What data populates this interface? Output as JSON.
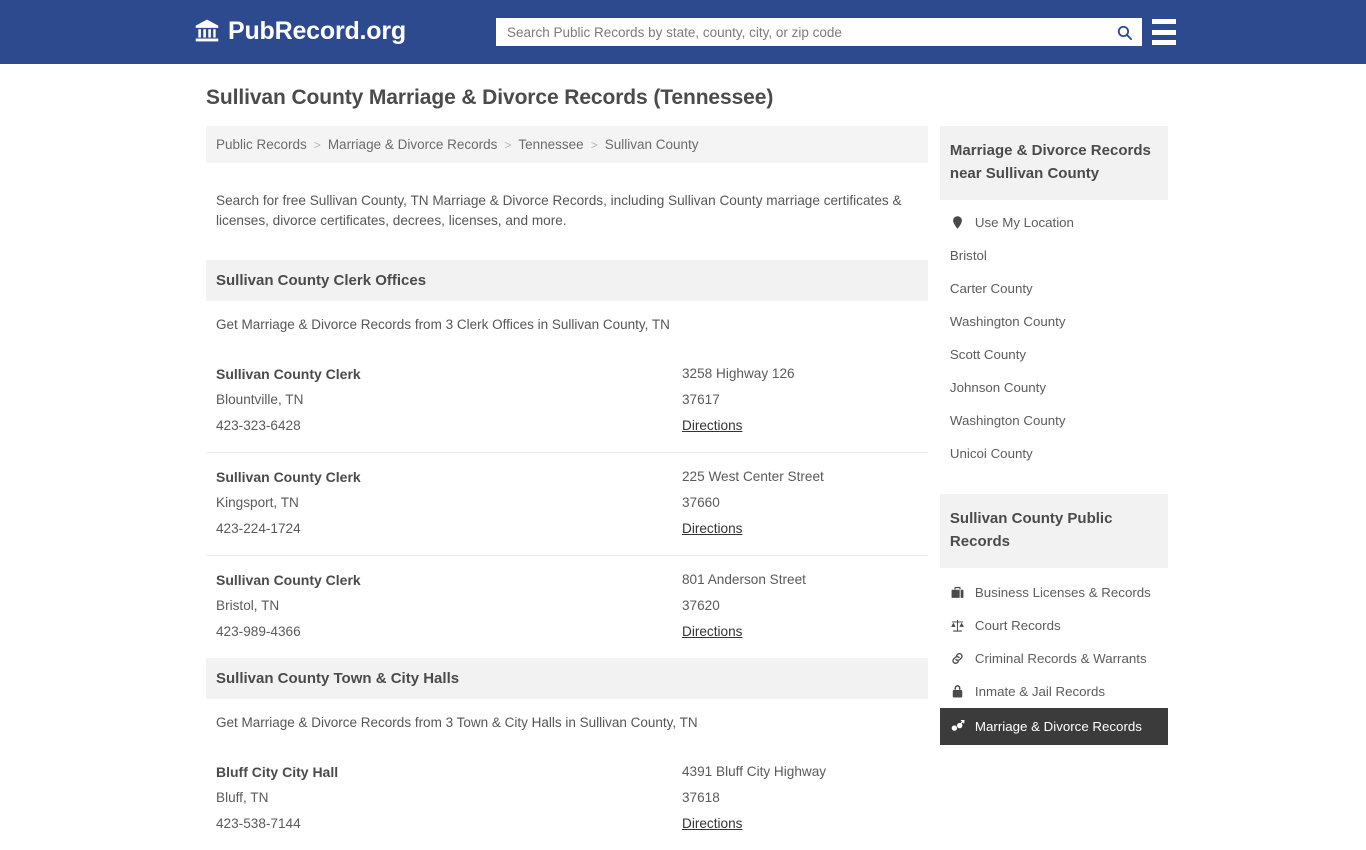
{
  "header": {
    "brand_icon": "bank-building-icon",
    "brand_text": "PubRecord.org",
    "search": {
      "placeholder": "Search Public Records by state, county, city, or zip code",
      "value": "",
      "icon": "search-icon"
    },
    "menu_icon": "hamburger-menu-icon",
    "background_color": "#2e4a8e"
  },
  "page": {
    "title": "Sullivan County Marriage & Divorce Records (Tennessee)",
    "breadcrumb": [
      "Public Records",
      "Marriage & Divorce Records",
      "Tennessee",
      "Sullivan County"
    ],
    "breadcrumb_separator": ">",
    "intro": "Search for free Sullivan County, TN Marriage & Divorce Records, including Sullivan County marriage certificates & licenses, divorce certificates, decrees, licenses, and more."
  },
  "sections": [
    {
      "heading": "Sullivan County Clerk Offices",
      "subheading": "Get Marriage & Divorce Records from 3 Clerk Offices in Sullivan County, TN",
      "rows": [
        {
          "name": "Sullivan County Clerk",
          "city": "Blountville, TN",
          "phone": "423-323-6428",
          "street": "3258 Highway 126",
          "zip": "37617",
          "directions": "Directions"
        },
        {
          "name": "Sullivan County Clerk",
          "city": "Kingsport, TN",
          "phone": "423-224-1724",
          "street": "225 West Center Street",
          "zip": "37660",
          "directions": "Directions"
        },
        {
          "name": "Sullivan County Clerk",
          "city": "Bristol, TN",
          "phone": "423-989-4366",
          "street": "801 Anderson Street",
          "zip": "37620",
          "directions": "Directions"
        }
      ]
    },
    {
      "heading": "Sullivan County Town & City Halls",
      "subheading": "Get Marriage & Divorce Records from 3 Town & City Halls in Sullivan County, TN",
      "rows": [
        {
          "name": "Bluff City City Hall",
          "city": "Bluff, TN",
          "phone": "423-538-7144",
          "street": "4391 Bluff City Highway",
          "zip": "37618",
          "directions": "Directions"
        }
      ]
    }
  ],
  "sidebar": {
    "nearby": {
      "heading": "Marriage & Divorce Records near Sullivan County",
      "items": [
        {
          "label": "Use My Location",
          "icon": "map-pin-icon"
        },
        {
          "label": "Bristol",
          "icon": null
        },
        {
          "label": "Carter County",
          "icon": null
        },
        {
          "label": "Washington County",
          "icon": null
        },
        {
          "label": "Scott County",
          "icon": null
        },
        {
          "label": "Johnson County",
          "icon": null
        },
        {
          "label": "Washington County",
          "icon": null
        },
        {
          "label": "Unicoi County",
          "icon": null
        }
      ]
    },
    "records": {
      "heading": "Sullivan County Public Records",
      "active_color": "#3b3b3b",
      "items": [
        {
          "label": "Business Licenses & Records",
          "icon": "briefcase-icon",
          "active": false
        },
        {
          "label": "Court Records",
          "icon": "scales-of-justice-icon",
          "active": false
        },
        {
          "label": "Criminal Records & Warrants",
          "icon": "chain-link-icon",
          "active": false
        },
        {
          "label": "Inmate & Jail Records",
          "icon": "lock-icon",
          "active": false
        },
        {
          "label": "Marriage & Divorce Records",
          "icon": "male-female-symbol-icon",
          "active": true
        }
      ]
    }
  }
}
